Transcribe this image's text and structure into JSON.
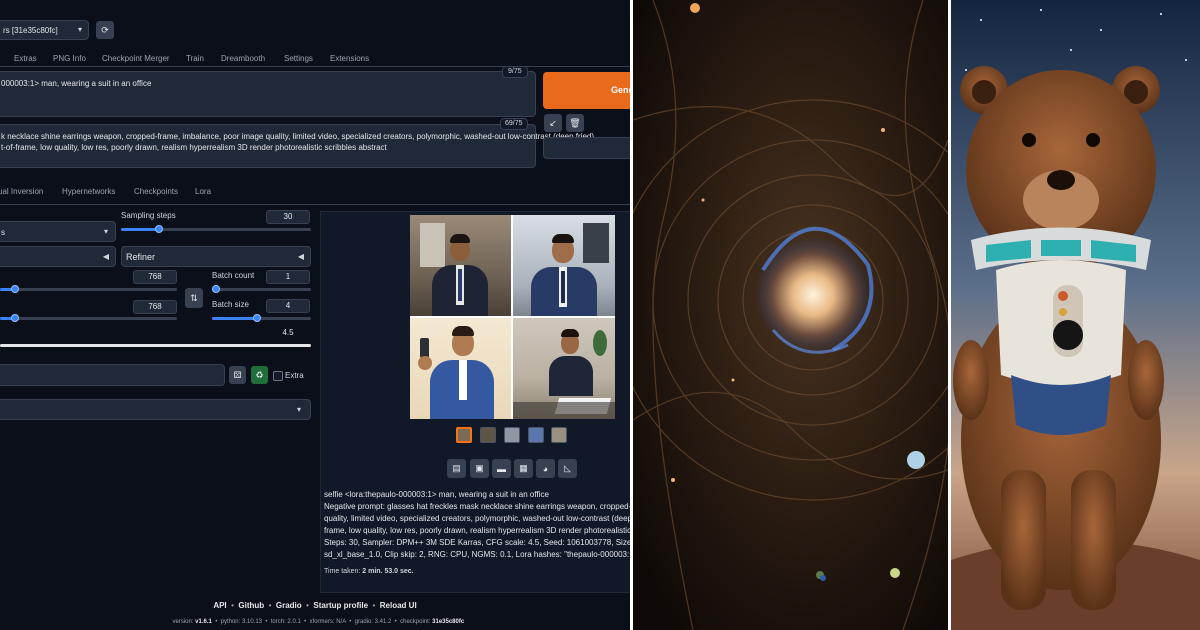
{
  "header": {
    "model_select": "rs [31e35c80fc]"
  },
  "tabs": [
    "Extras",
    "PNG Info",
    "Checkpoint Merger",
    "Train",
    "Dreambooth",
    "Settings",
    "Extensions"
  ],
  "prompt": {
    "text": "000003:1> man, wearing a suit in an office",
    "token_count": "9/75",
    "negative_line1": "k necklace shine earrings weapon, cropped-frame, imbalance, poor image quality, limited video, specialized creators, polymorphic, washed-out low-contrast (deep fried)",
    "negative_line2": "t-of-frame, low quality, low res, poorly drawn, realism hyperrealism 3D render photorealistic scribbles abstract",
    "negative_token_count": "69/75"
  },
  "generate_label": "Gene",
  "extra_tabs": [
    "ual Inversion",
    "Hypernetworks",
    "Checkpoints",
    "Lora"
  ],
  "params": {
    "sampling_steps_label": "Sampling steps",
    "sampling_steps": "30",
    "sampler_value": "s",
    "refiner_label": "Refiner",
    "width": "768",
    "height": "768",
    "batch_count_label": "Batch count",
    "batch_count": "1",
    "batch_size_label": "Batch size",
    "batch_size": "4",
    "cfg_scale": "4.5",
    "extra_label": "Extra"
  },
  "output": {
    "info_line1": "selfie <lora:thepaulo-000003:1> man, wearing a suit in an office",
    "info_line2": "Negative prompt: glasses hat freckles mask necklace shine earrings weapon, cropped-frame, imbalar",
    "info_line3": "quality, limited video, specialized creators, polymorphic, washed-out low-contrast (deep fried) wate",
    "info_line4": "frame, low quality, low res, poorly drawn, realism hyperrealism 3D render photorealistic scribbles ab:",
    "info_line5": "Steps: 30, Sampler: DPM++ 3M SDE Karras, CFG scale: 4.5, Seed: 1061003778, Size: 768x768, Model ha",
    "info_line6": "sd_xl_base_1.0, Clip skip: 2, RNG: CPU, NGMS: 0.1, Lora hashes: \"thepaulo-000003: bc117f4e2e5d\", V",
    "time_taken_label": "Time taken:",
    "time_taken_value": "2 min. 53.0 sec."
  },
  "footer": {
    "links": [
      "API",
      "Github",
      "Gradio",
      "Startup profile",
      "Reload UI"
    ],
    "separator": "•",
    "version_prefix": "version: ",
    "version": "v1.6.1",
    "python_prefix": "  •  python: 3.10.13  •  torch: 2.0.1  •  xformers: N/A  •  gradio: 3.41.2  •  checkpoint: ",
    "checkpoint": "31e35c80fc"
  },
  "colors": {
    "background": "#0b0f19",
    "accent": "#f97316",
    "slider": "#3b82f6"
  }
}
